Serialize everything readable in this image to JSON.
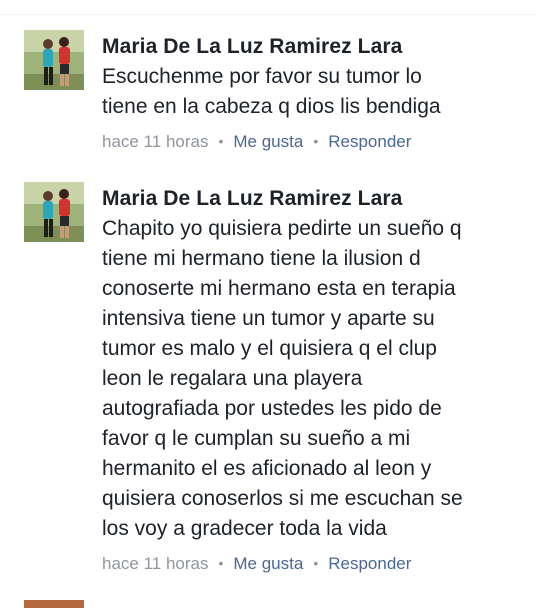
{
  "comments": [
    {
      "author": "Maria De La Luz Ramirez Lara",
      "text_lines": [
        "Escuchenme por favor su tumor lo",
        "tiene en la cabeza q dios lis bendiga"
      ],
      "time": "hace 11 horas",
      "like": "Me gusta",
      "reply": "Responder"
    },
    {
      "author": "Maria De La Luz Ramirez Lara",
      "text_lines": [
        "Chapito yo quisiera pedirte un sueño q",
        "tiene mi hermano tiene la ilusion d",
        "conoserte mi hermano esta en terapia",
        "intensiva tiene un tumor y aparte su",
        "tumor es malo y el quisiera q el clup",
        "leon le regalara una playera",
        "autografiada por ustedes les pido de",
        "favor q le cumplan su sueño a mi",
        "hermanito el es aficionado al leon y",
        "quisiera conoserlos si me escuchan se",
        "los voy a gradecer toda la vida"
      ],
      "time": "hace 11 horas",
      "like": "Me gusta",
      "reply": "Responder"
    }
  ],
  "separator": "•"
}
